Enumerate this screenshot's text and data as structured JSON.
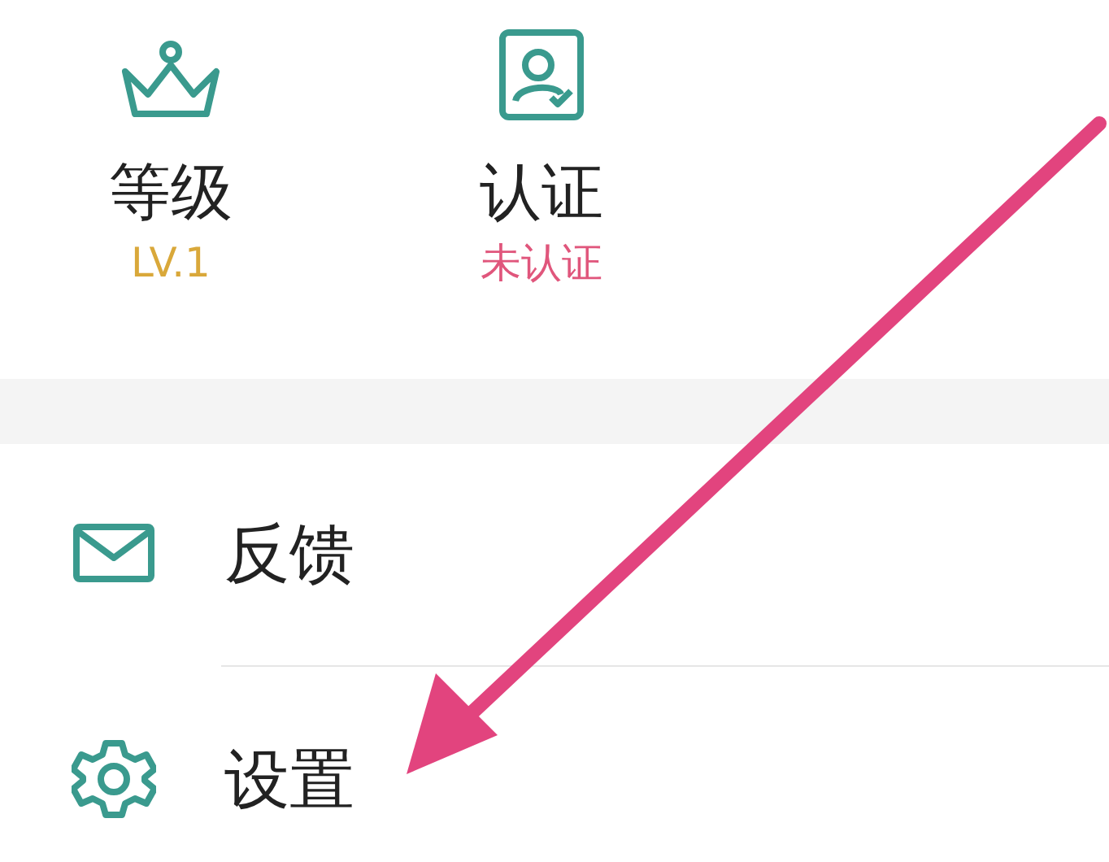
{
  "stats": [
    {
      "label": "等级",
      "value": "LV.1",
      "color": "#d9a83a",
      "kind": "crown"
    },
    {
      "label": "认证",
      "value": "未认证",
      "color": "#e0567c",
      "kind": "badge"
    }
  ],
  "menu": [
    {
      "label": "反馈",
      "kind": "mail"
    },
    {
      "label": "设置",
      "kind": "settings"
    }
  ]
}
